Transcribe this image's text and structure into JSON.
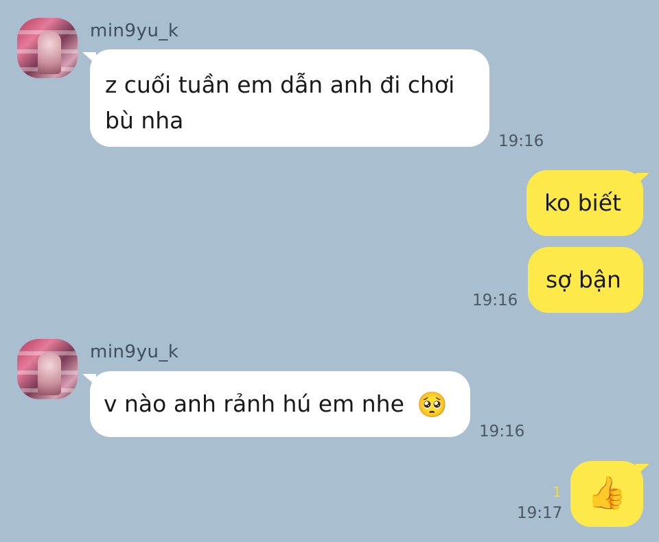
{
  "chat": {
    "messages": [
      {
        "sender": "min9yu_k",
        "text_line1": "z cuối tuần em dẫn anh đi chơi",
        "text_line2": "bù nha",
        "time": "19:16"
      },
      {
        "text": "ko biết"
      },
      {
        "text": "sợ bận",
        "time": "19:16"
      },
      {
        "sender": "min9yu_k",
        "text": "v nào anh rảnh hú em nhe",
        "emoji": "🥺",
        "emoji_icon": "pleading-face-icon",
        "time": "19:16"
      },
      {
        "emoji": "👍",
        "emoji_icon": "thumbs-up-icon",
        "unread": "1",
        "time": "19:17"
      }
    ]
  },
  "colors": {
    "background": "#a9bfd0",
    "incoming_bubble": "#ffffff",
    "outgoing_bubble": "#fee94b",
    "unread_count": "#f3dc2c"
  }
}
